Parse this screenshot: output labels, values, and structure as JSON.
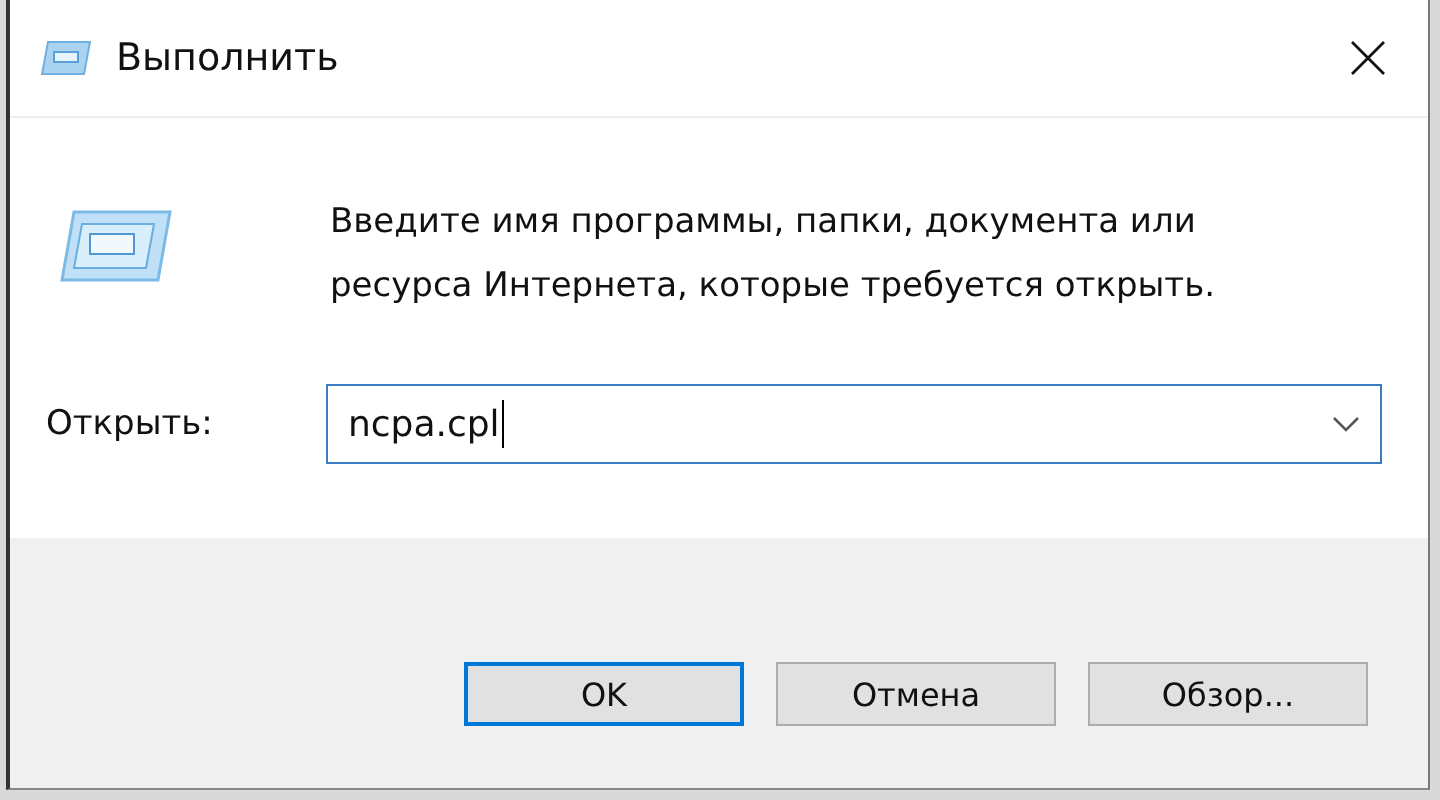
{
  "window": {
    "title": "Выполнить"
  },
  "prompt": "Введите имя программы, папки, документа или ресурса Интернета, которые требуется открыть.",
  "open_field": {
    "label": "Открыть:",
    "value": "ncpa.cpl"
  },
  "buttons": [
    {
      "label": "OK",
      "default": true
    },
    {
      "label": "Отмена",
      "default": false
    },
    {
      "label": "Обзор...",
      "default": false
    }
  ]
}
